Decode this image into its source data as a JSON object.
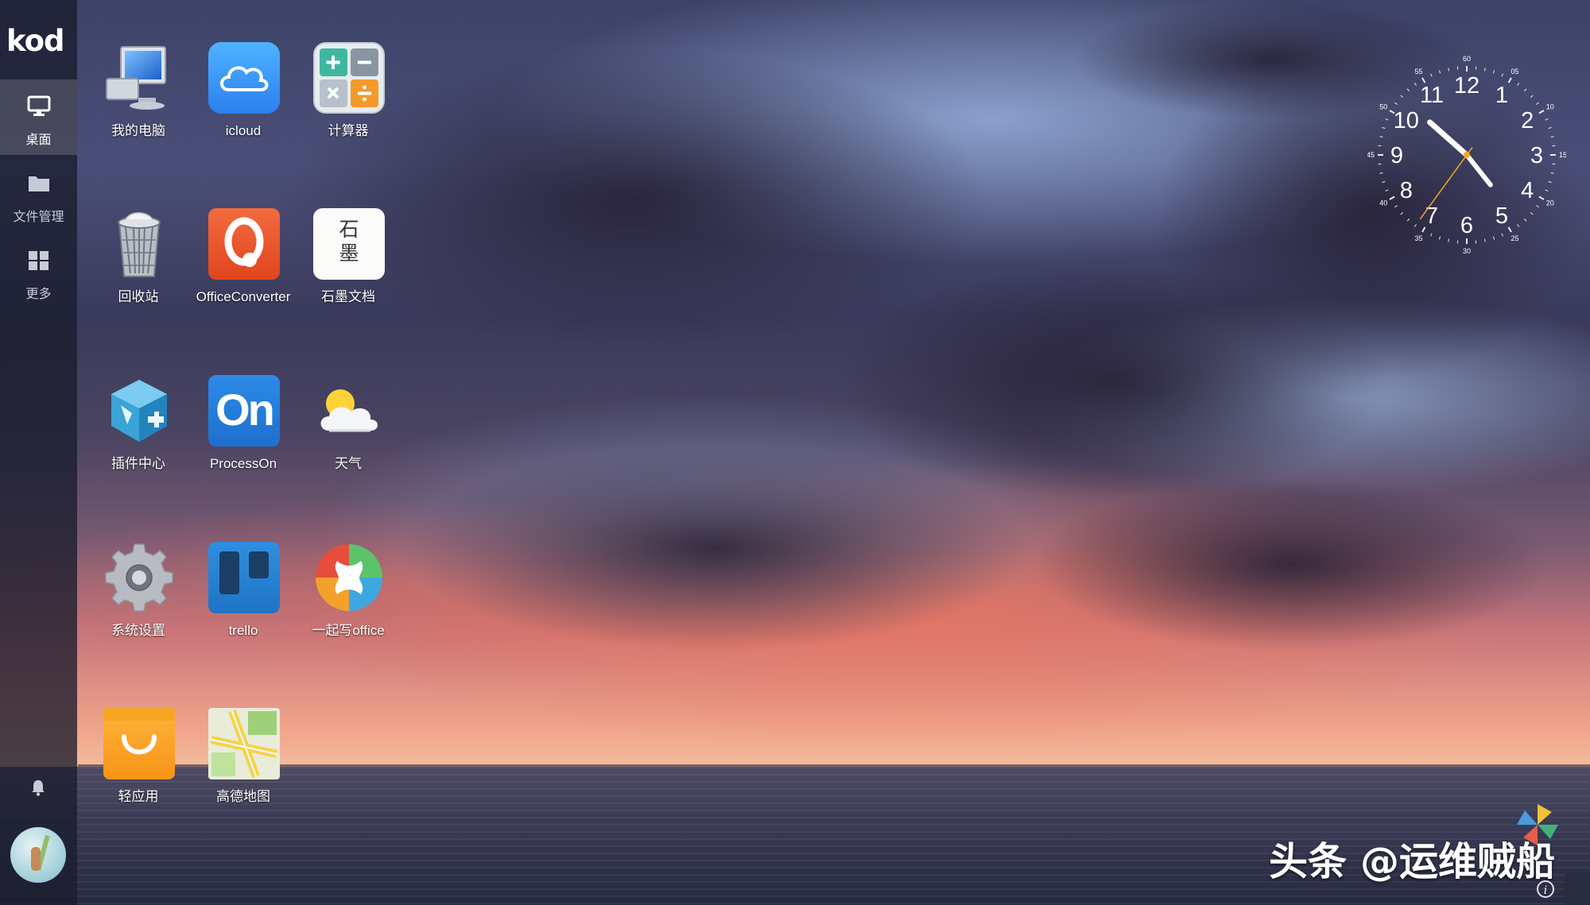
{
  "sidebar": {
    "logo": "kod",
    "items": [
      {
        "label": "桌面",
        "icon": "monitor-icon",
        "active": true
      },
      {
        "label": "文件管理",
        "icon": "folder-icon",
        "active": false
      },
      {
        "label": "更多",
        "icon": "grid-icon",
        "active": false
      }
    ],
    "notification_icon": "bell-icon",
    "avatar_icon": "user-avatar"
  },
  "desktop": {
    "apps": [
      {
        "label": "我的电脑",
        "icon": "computer-icon"
      },
      {
        "label": "icloud",
        "icon": "icloud-icon"
      },
      {
        "label": "计算器",
        "icon": "calculator-icon"
      },
      {
        "label": "回收站",
        "icon": "recycle-bin-icon"
      },
      {
        "label": "OfficeConverter",
        "icon": "office-converter-icon"
      },
      {
        "label": "石墨文档",
        "icon": "shimo-docs-icon",
        "icon_text": "石\n墨"
      },
      {
        "label": "插件中心",
        "icon": "plugin-center-icon"
      },
      {
        "label": "ProcessOn",
        "icon": "processon-icon",
        "icon_text": "On"
      },
      {
        "label": "天气",
        "icon": "weather-icon"
      },
      {
        "label": "系统设置",
        "icon": "gear-icon"
      },
      {
        "label": "trello",
        "icon": "trello-icon"
      },
      {
        "label": "一起写office",
        "icon": "yiqixie-icon"
      },
      {
        "label": "轻应用",
        "icon": "shopping-bag-icon"
      },
      {
        "label": "高德地图",
        "icon": "map-icon"
      }
    ]
  },
  "clock": {
    "hour_numbers": [
      "12",
      "1",
      "2",
      "3",
      "4",
      "5",
      "6",
      "7",
      "8",
      "9",
      "10",
      "11"
    ],
    "minute_numbers": [
      "60",
      "05",
      "10",
      "15",
      "20",
      "25",
      "30",
      "35",
      "40",
      "45",
      "50",
      "55"
    ],
    "time": {
      "hour": 10,
      "minute": 23,
      "second": 36
    }
  },
  "watermark": {
    "text": "头条 @运维贼船"
  },
  "info_button": "i",
  "colors": {
    "sidebar_bg": "#191c2d",
    "sunset_orange": "#ee8a6a",
    "sky_blue": "#96afdc",
    "clock_second_hand": "#f5a623"
  }
}
